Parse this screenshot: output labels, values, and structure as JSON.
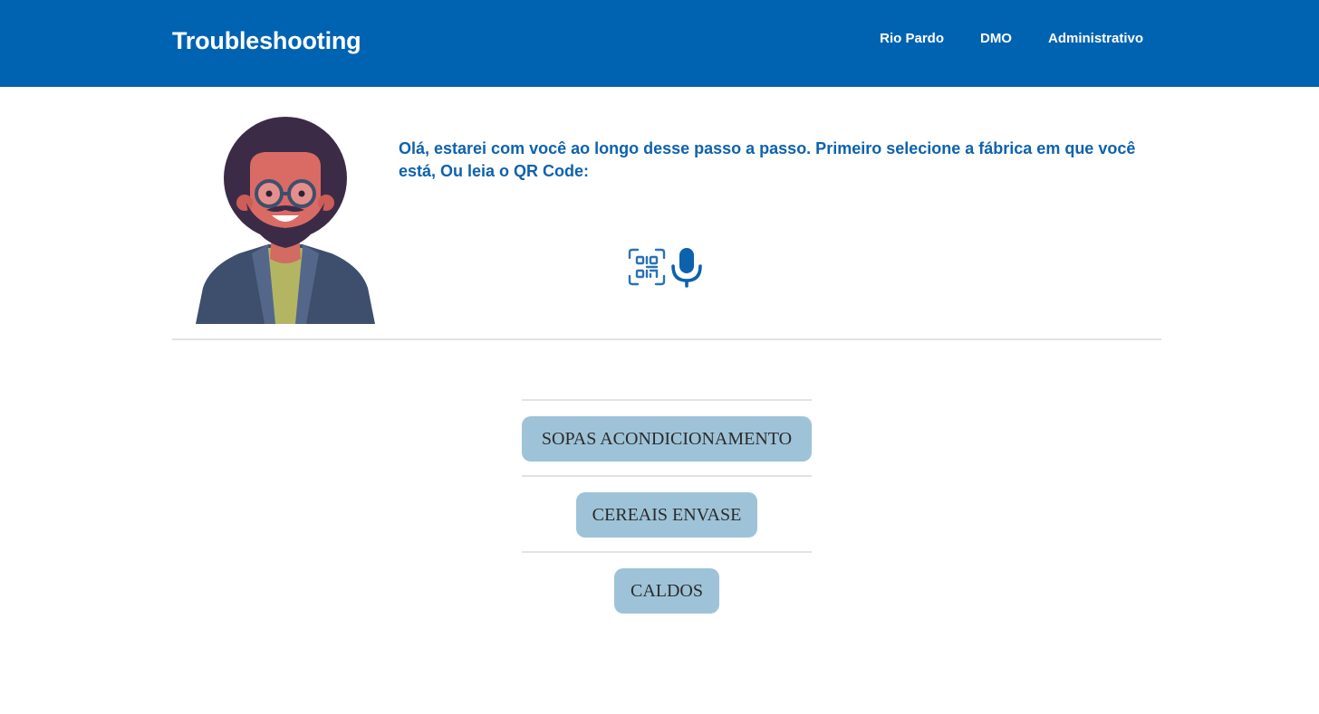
{
  "navbar": {
    "brand": "Troubleshooting",
    "links": [
      "Rio Pardo",
      "DMO",
      "Administrativo"
    ]
  },
  "assistant": {
    "avatar_icon": "bearded-man-avatar-icon",
    "message": "Olá, estarei com você ao longo desse passo a passo. Primeiro selecione a fábrica em que você está, Ou leia o QR Code:"
  },
  "actions": {
    "qr_icon": "qr-code-scan-icon",
    "mic_icon": "microphone-icon"
  },
  "factories": [
    "SOPAS ACONDICIONAMENTO",
    "CEREAIS ENVASE",
    "CALDOS"
  ],
  "colors": {
    "header": "#0063b1",
    "message_text": "#0d62ad",
    "button_bg": "#9ec3d8",
    "divider": "#e2e2e2"
  }
}
